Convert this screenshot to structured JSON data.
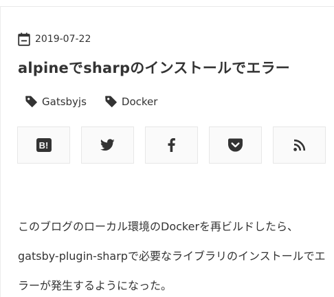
{
  "post": {
    "date": "2019-07-22",
    "title": "alpineでsharpのインストールでエラー",
    "tags": [
      {
        "label": "Gatsbyjs"
      },
      {
        "label": "Docker"
      }
    ],
    "body": "このブログのローカル環境のDockerを再ビルドしたら、gatsby-plugin-sharpで必要なライブラリのインストールでエラーが発生するようになった。"
  },
  "share": {
    "buttons": [
      {
        "name": "hatena-bookmark",
        "icon": "hatena-b-icon",
        "glyph": "B!"
      },
      {
        "name": "twitter",
        "icon": "twitter-bird-icon"
      },
      {
        "name": "facebook",
        "icon": "facebook-f-icon"
      },
      {
        "name": "pocket",
        "icon": "pocket-icon"
      },
      {
        "name": "rss",
        "icon": "rss-feed-icon"
      }
    ]
  },
  "colors": {
    "text": "#333333",
    "icon": "#333333",
    "button_bg": "#fafafa",
    "button_border": "#e7e7e7"
  }
}
